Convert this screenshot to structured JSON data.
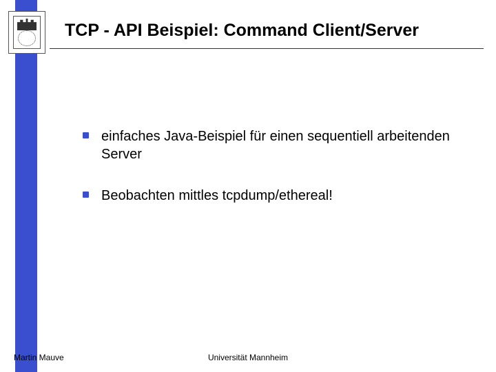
{
  "slide": {
    "title": "TCP - API Beispiel: Command Client/Server",
    "bullets": [
      "einfaches Java-Beispiel für einen sequentiell arbeitenden Server",
      "Beobachten mittles tcpdump/ethereal!"
    ],
    "footer": {
      "author": "Martin Mauve",
      "affiliation": "Universität Mannheim"
    }
  }
}
